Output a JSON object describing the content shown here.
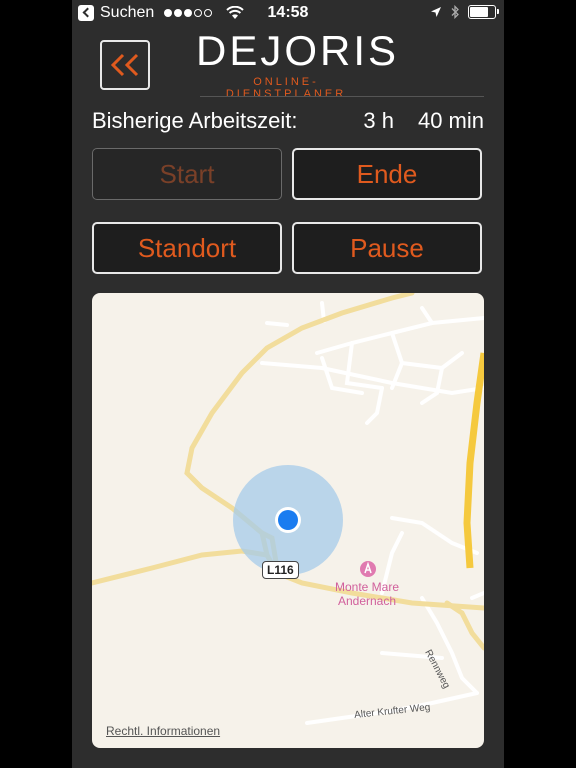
{
  "status_bar": {
    "back_app": "Suchen",
    "time": "14:58"
  },
  "header": {
    "logo_text": "DEJORIS",
    "logo_subtitle": "ONLINE-DIENSTPLANER",
    "back_icon": "double-chevron-left-icon",
    "accent_color": "#e05a1e"
  },
  "worktime": {
    "label": "Bisherige Arbeitszeit:",
    "hours": "3 h",
    "minutes": "40 min"
  },
  "buttons": {
    "start": "Start",
    "end": "Ende",
    "location": "Standort",
    "pause": "Pause"
  },
  "map": {
    "road_label": "L116",
    "poi_label_line1": "Monte Mare",
    "poi_label_line2": "Andernach",
    "street_1": "Rennweg",
    "street_2": "Alter Krufter Weg",
    "legal": "Rechtl. Informationen"
  }
}
